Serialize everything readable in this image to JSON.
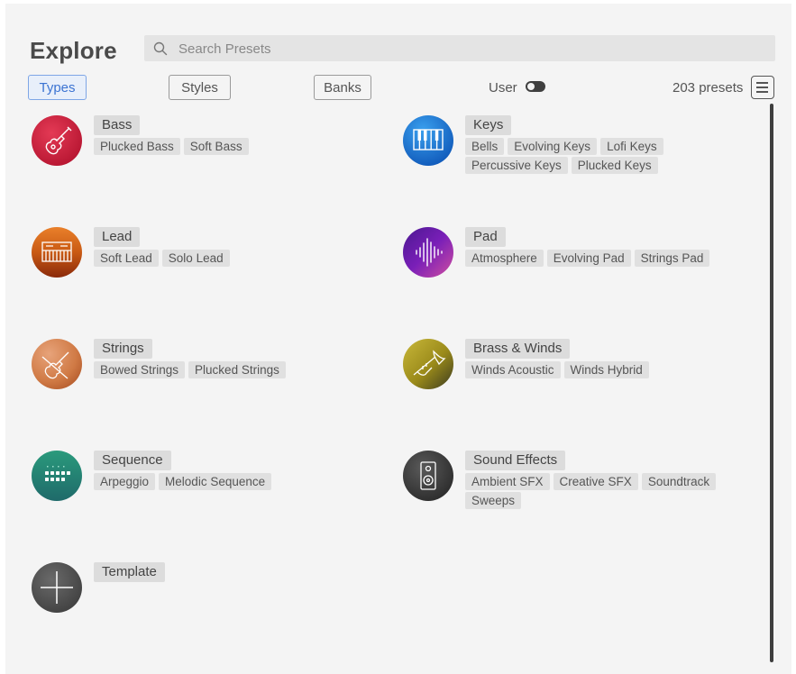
{
  "header": {
    "title": "Explore",
    "search_placeholder": "Search Presets"
  },
  "tabs": [
    {
      "label": "Types",
      "active": true
    },
    {
      "label": "Styles",
      "active": false
    },
    {
      "label": "Banks",
      "active": false
    }
  ],
  "user_filter": {
    "label": "User",
    "enabled": false
  },
  "preset_count": "203 presets",
  "accent_color": "#3b73d2",
  "categories": [
    {
      "name": "Bass",
      "icon": "bass-guitar-icon",
      "tags": [
        "Plucked Bass",
        "Soft Bass"
      ]
    },
    {
      "name": "Keys",
      "icon": "piano-keys-icon",
      "tags": [
        "Bells",
        "Evolving Keys",
        "Lofi Keys",
        "Percussive Keys",
        "Plucked Keys"
      ]
    },
    {
      "name": "Lead",
      "icon": "synthesizer-icon",
      "tags": [
        "Soft Lead",
        "Solo Lead"
      ]
    },
    {
      "name": "Pad",
      "icon": "waveform-icon",
      "tags": [
        "Atmosphere",
        "Evolving Pad",
        "Strings Pad"
      ]
    },
    {
      "name": "Strings",
      "icon": "violin-icon",
      "tags": [
        "Bowed Strings",
        "Plucked Strings"
      ]
    },
    {
      "name": "Brass & Winds",
      "icon": "trumpet-icon",
      "tags": [
        "Winds Acoustic",
        "Winds Hybrid"
      ]
    },
    {
      "name": "Sequence",
      "icon": "step-sequencer-icon",
      "tags": [
        "Arpeggio",
        "Melodic Sequence"
      ]
    },
    {
      "name": "Sound Effects",
      "icon": "speaker-icon",
      "tags": [
        "Ambient SFX",
        "Creative SFX",
        "Soundtrack",
        "Sweeps"
      ]
    },
    {
      "name": "Template",
      "icon": "plus-icon",
      "tags": []
    }
  ]
}
